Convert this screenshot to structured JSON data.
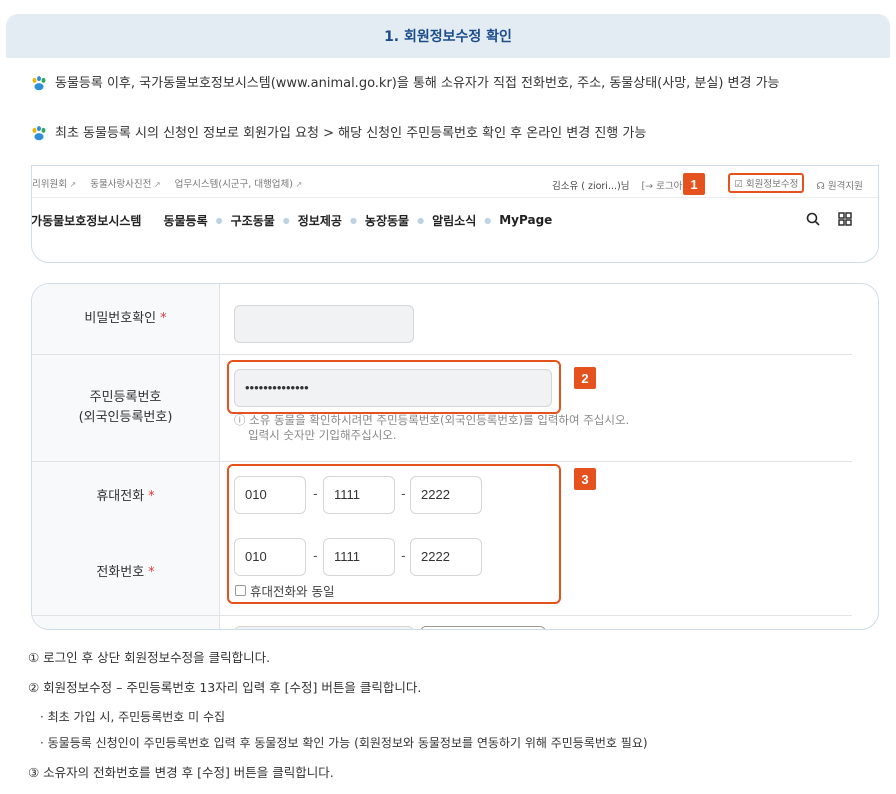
{
  "section_title": "1. 회원정보수정 확인",
  "bullets": [
    "동물등록 이후, 국가동물보호정보시스템(www.animal.go.kr)을 통해 소유자가 직접 전화번호, 주소, 동물상태(사망, 분실) 변경 가능",
    "최초 동물등록 시의 신청인 정보로 회원가입 요청 > 해당 신청인 주민등록번호 확인 후 온라인 변경 진행 가능"
  ],
  "site": {
    "util_links": [
      "리위원회",
      "동물사랑사진전",
      "업무시스템(시군구, 대행업체)"
    ],
    "user": "김소유 ( ziori...)님",
    "login": "[→ 로그아",
    "edit_profile": "회원정보수정",
    "remote_support": "원격지원",
    "logo": "국가동물보호정보시스템",
    "menu": [
      "동물등록",
      "구조동물",
      "정보제공",
      "농장동물",
      "알림소식",
      "MyPage"
    ]
  },
  "badges": [
    "1",
    "2",
    "3"
  ],
  "form": {
    "pw_confirm_label": "비밀번호확인",
    "required_mark": "*",
    "rrn_label_1": "주민등록번호",
    "rrn_label_2": "(외국인등록번호)",
    "rrn_value": "••••••••••••••",
    "rrn_hint_1": "ⓘ 소유 동물을 확인하시려면 주민등록번호(외국인등록번호)를 입력하여 주십시오.",
    "rrn_hint_2": "입력시 숫자만 기입해주십시오.",
    "mobile_label": "휴대전화",
    "mobile": [
      "010",
      "1111",
      "2222"
    ],
    "phone_label": "전화번호",
    "phone": [
      "010",
      "1111",
      "2222"
    ],
    "dash": "-",
    "same_as_mobile": "휴대전화와 동일"
  },
  "notes": [
    "① 로그인 후 상단 회원정보수정을 클릭합니다.",
    "② 회원정보수정 – 주민등록번호 13자리 입력 후 [수정] 버튼을 클릭합니다.",
    "· 최초 가입 시, 주민등록번호 미 수집",
    "· 동물등록 신청인이 주민등록번호 입력 후 동물정보 확인 가능 (회원정보와 동물정보를 연동하기 위해 주민등록번호 필요)",
    "③ 소유자의 전화번호를 변경 후 [수정] 버튼을 클릭합니다."
  ],
  "colors": {
    "accent": "#e5521d",
    "header_bg": "#e3ecf2",
    "title": "#1b4d8c",
    "paw": "#2f8fd6"
  }
}
